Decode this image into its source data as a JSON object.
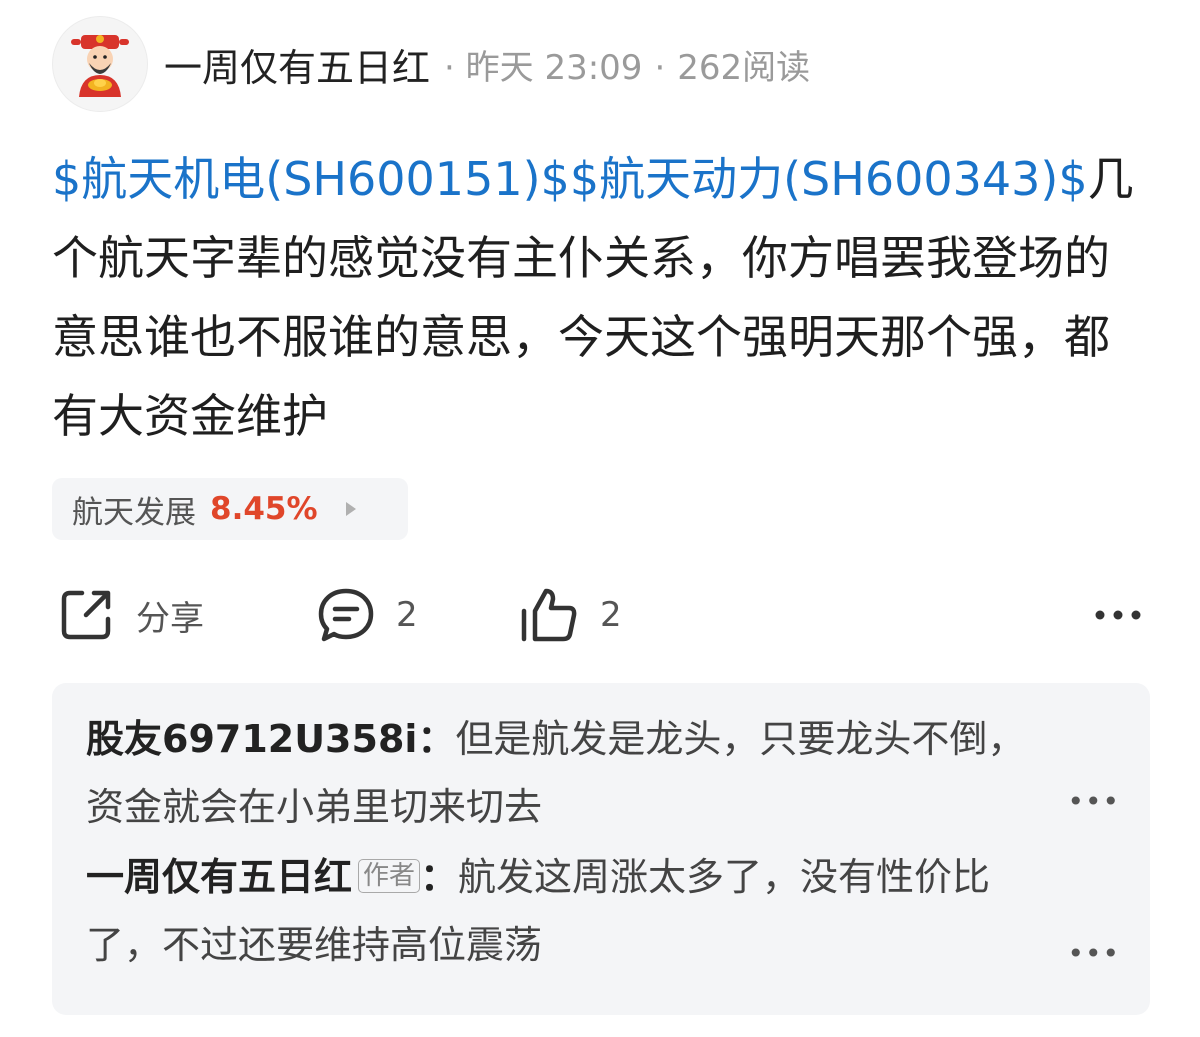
{
  "post": {
    "author": "一周仅有五日红",
    "time": "昨天 23:09",
    "reads": "262阅读",
    "stock_link_1": "$航天机电(SH600151)$",
    "stock_link_2": "$航天动力(SH600343)$",
    "body_text": "几个航天字辈的感觉没有主仆关系，你方唱罢我登场的意思谁也不服谁的意思，今天这个强明天那个强，都有大资金维护"
  },
  "topic": {
    "name": "航天发展",
    "change": "8.45%"
  },
  "actions": {
    "share_label": "分享",
    "comment_count": "2",
    "like_count": "2"
  },
  "comments": [
    {
      "author": "股友69712U358i",
      "separator": "：",
      "text": "但是航发是龙头，只要龙头不倒，资金就会在小弟里切来切去"
    },
    {
      "author": "一周仅有五日红",
      "tag": "作者",
      "separator": "：",
      "text": "航发这周涨太多了，没有性价比了，不过还要维持高位震荡"
    }
  ],
  "icons": {
    "avatar": "caishen-avatar",
    "share": "share-icon",
    "comment": "comment-icon",
    "like": "thumbs-up-icon",
    "more": "more-horizontal-icon"
  },
  "colors": {
    "link": "#1a73c9",
    "gain": "#e0462a",
    "panel_bg": "#f4f5f7"
  }
}
